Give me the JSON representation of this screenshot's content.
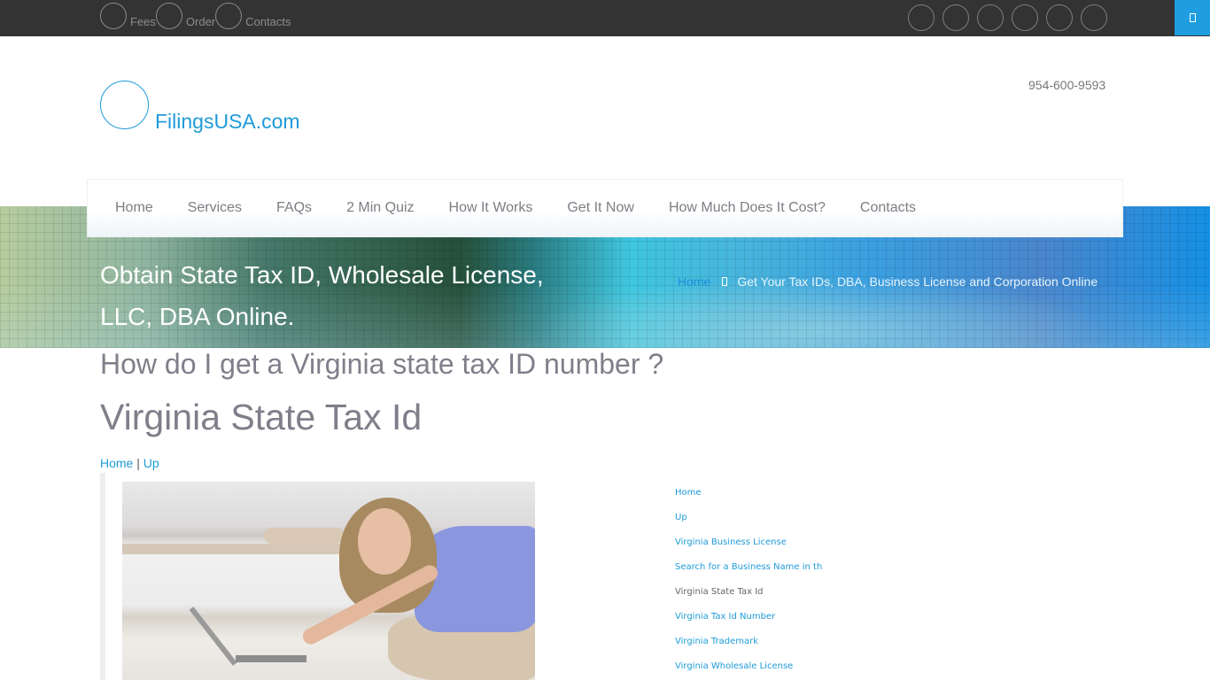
{
  "topbar": {
    "links": [
      {
        "label": "Fees",
        "icon": "circle-icon"
      },
      {
        "label": "Order",
        "icon": "circle-icon"
      },
      {
        "label": "Contacts",
        "icon": "circle-icon"
      }
    ],
    "social_icons": [
      "social-icon-1",
      "social-icon-2",
      "social-icon-3",
      "social-icon-4",
      "social-icon-5",
      "social-icon-6"
    ],
    "corner_button_icon": "menu-icon",
    "colors": {
      "background": "#333333",
      "corner_button": "#1e9ee0"
    }
  },
  "header": {
    "logo_text": "FilingsUSA.com",
    "phone": "954-600-9593",
    "brand_color": "#1f9bd9"
  },
  "mainnav": {
    "items": [
      {
        "label": "Home"
      },
      {
        "label": "Services"
      },
      {
        "label": "FAQs"
      },
      {
        "label": "2 Min Quiz"
      },
      {
        "label": "How It Works"
      },
      {
        "label": "Get It Now"
      },
      {
        "label": "How Much Does It Cost?"
      },
      {
        "label": "Contacts"
      }
    ]
  },
  "banner": {
    "title": "Obtain State Tax ID, Wholesale License, LLC, DBA Online.",
    "breadcrumb": {
      "home": "Home",
      "separator_icon": "chevron-right-icon",
      "current": "Get Your Tax IDs, DBA, Business License and Corporation Online"
    }
  },
  "content": {
    "question_title": "How do I get a Virginia state tax ID number ?",
    "page_title": "Virginia State Tax Id",
    "subnav": {
      "home": "Home",
      "separator": "|",
      "up": "Up"
    },
    "image_alt": "Woman sitting on carpet using laptop"
  },
  "sidenav": {
    "items": [
      {
        "label": "Home",
        "current": false
      },
      {
        "label": "Up",
        "current": false
      },
      {
        "label": "Virginia Business License",
        "current": false
      },
      {
        "label": "Search for a Business Name in th",
        "current": false
      },
      {
        "label": "Virginia State Tax Id",
        "current": true
      },
      {
        "label": "Virginia Tax Id Number",
        "current": false
      },
      {
        "label": "Virginia Trademark",
        "current": false
      },
      {
        "label": "Virginia Wholesale License",
        "current": false
      }
    ]
  }
}
